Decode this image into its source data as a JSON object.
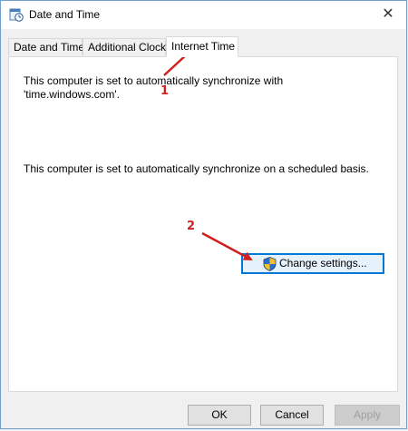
{
  "window": {
    "title": "Date and Time",
    "close_glyph": "✕"
  },
  "tabs": [
    {
      "label": "Date and Time"
    },
    {
      "label": "Additional Clocks"
    },
    {
      "label": "Internet Time"
    }
  ],
  "panel": {
    "sync_line1": "This computer is set to automatically synchronize with",
    "sync_line2": "'time.windows.com'.",
    "schedule_text": "This computer is set to automatically synchronize on a scheduled basis.",
    "change_settings_label": "Change settings..."
  },
  "footer": {
    "ok_label": "OK",
    "cancel_label": "Cancel",
    "apply_label": "Apply"
  },
  "annotations": {
    "marker1": "1",
    "marker2": "2"
  },
  "colors": {
    "accent": "#0078d7",
    "annotation": "#d21f1f",
    "border": "#6f9fcf"
  },
  "icons": {
    "title": "clock-icon",
    "button": "uac-shield-icon"
  }
}
